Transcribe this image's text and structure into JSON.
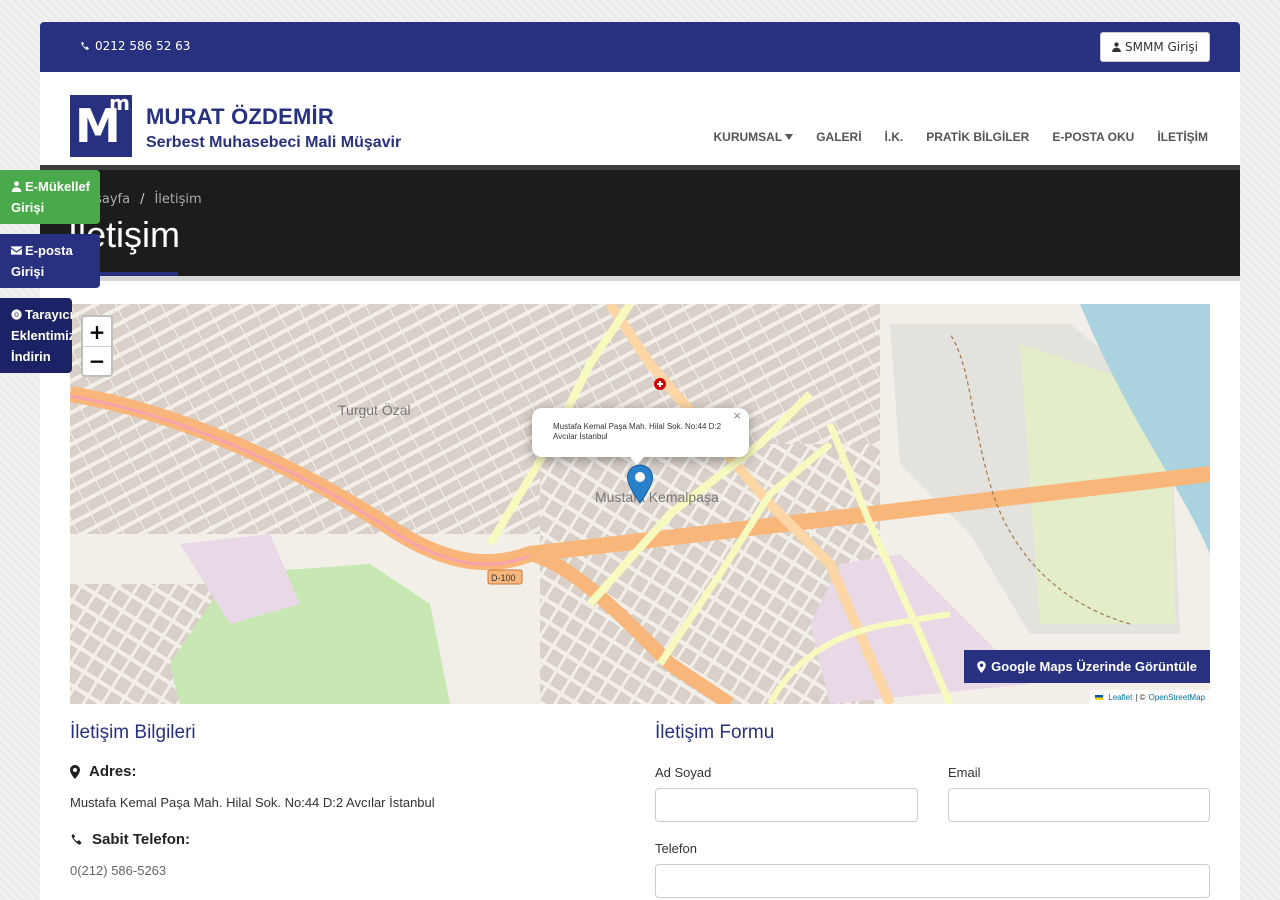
{
  "topbar": {
    "phone": "0212 586 52 63",
    "smmm_label": "SMMM Girişi"
  },
  "brand": {
    "logo_big": "M",
    "logo_small": "m",
    "name": "MURAT ÖZDEMİR",
    "subtitle": "Serbest Muhasebeci Mali Müşavir"
  },
  "nav": [
    {
      "label": "KURUMSAL",
      "dropdown": true
    },
    {
      "label": "GALERİ"
    },
    {
      "label": "İ.K."
    },
    {
      "label": "PRATİK BİLGİLER"
    },
    {
      "label": "E-POSTA OKU"
    },
    {
      "label": "İLETİŞİM"
    }
  ],
  "breadcrumb": {
    "home": "Anasayfa",
    "separator": "/",
    "current": "İletişim"
  },
  "page_title": "İletişim",
  "side_buttons": [
    {
      "line1": "E-Mükellef",
      "line2": "Girişi",
      "color": "#4aa94a",
      "icon": "user-icon"
    },
    {
      "line1": "E-posta",
      "line2": "Girişi",
      "color": "#283180",
      "icon": "envelope-icon"
    },
    {
      "line1": "Tarayıcı",
      "line2": "Eklentimizi",
      "line3": "İndirin",
      "color": "#1c2266",
      "icon": "chrome-icon"
    }
  ],
  "map": {
    "zoom_in": "+",
    "zoom_out": "−",
    "popup_text": "Mustafa Kemal Paşa Mah. Hilal Sok. No:44 D:2 Avcılar İstanbul",
    "popup_close": "×",
    "place_label": "Mustafa Kemalpaşa",
    "district_label": "Turgut Özal",
    "gmaps_label": "Google Maps Üzerinde Görüntüle",
    "attribution_leaflet": "Leaflet",
    "attribution_sep": "| ©",
    "attribution_osm": "OpenStreetMap",
    "highway_label": "D-100"
  },
  "contact_info": {
    "title": "İletişim Bilgileri",
    "address_label": "Adres:",
    "address_value": "Mustafa Kemal Paşa Mah. Hilal Sok. No:44 D:2 Avcılar İstanbul",
    "phone_label": "Sabit Telefon:",
    "phone_value": "0(212) 586-5263"
  },
  "contact_form": {
    "title": "İletişim Formu",
    "name_label": "Ad Soyad",
    "email_label": "Email",
    "phone_label": "Telefon"
  },
  "colors": {
    "primary": "#283180",
    "dark_banner": "#1c1c1c",
    "green": "#4aa94a"
  }
}
